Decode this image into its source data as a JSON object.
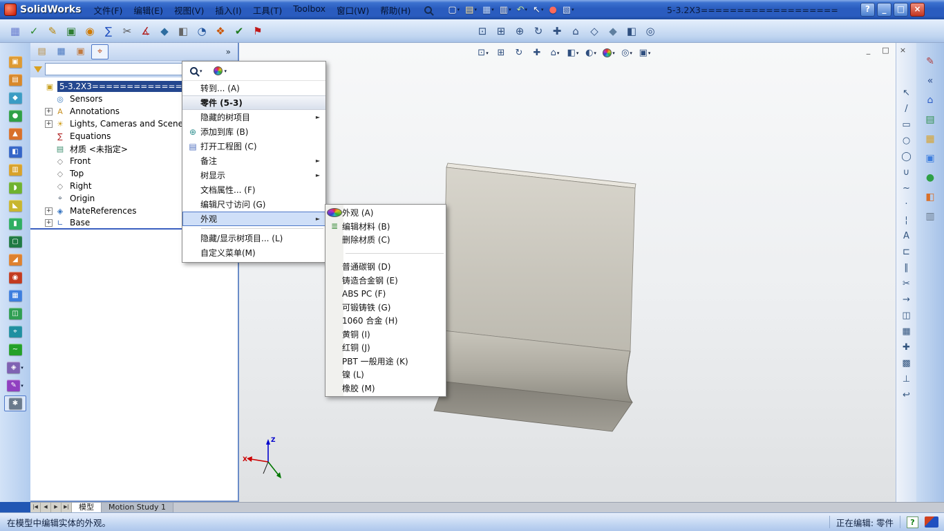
{
  "colors": {
    "selection": "#24478f",
    "menu_highlight": "#cfdff8",
    "menu_highlight_border": "#4d77c8",
    "chrome_blue": "#b2ccee"
  },
  "titlebar": {
    "logo": "SolidWorks",
    "doc_title": "5-3.2X3===================",
    "menus": [
      {
        "name": "menu-file",
        "label": "文件(F)"
      },
      {
        "name": "menu-edit",
        "label": "编辑(E)"
      },
      {
        "name": "menu-view",
        "label": "视图(V)"
      },
      {
        "name": "menu-insert",
        "label": "插入(I)"
      },
      {
        "name": "menu-tools",
        "label": "工具(T)"
      },
      {
        "name": "menu-toolbox",
        "label": "Toolbox"
      },
      {
        "name": "menu-window",
        "label": "窗口(W)"
      },
      {
        "name": "menu-help",
        "label": "帮助(H)"
      }
    ],
    "quick_icons": [
      {
        "name": "new-document-icon",
        "glyph": "▢",
        "color": "#ffffff",
        "drop": "▾"
      },
      {
        "name": "open-icon",
        "glyph": "▤",
        "color": "#ffe9a8",
        "drop": "▾"
      },
      {
        "name": "save-icon",
        "glyph": "▦",
        "color": "#bcd6ff",
        "drop": "▾"
      },
      {
        "name": "print-icon",
        "glyph": "▥",
        "color": "#e8e8e8",
        "drop": "▾"
      },
      {
        "name": "undo-icon",
        "glyph": "↶",
        "color": "#c4e6a6",
        "drop": "▾"
      },
      {
        "name": "select-arrow-icon",
        "glyph": "↖",
        "color": "#ffffff",
        "drop": "▾"
      },
      {
        "name": "rebuild-icon",
        "glyph": "●",
        "color": "#ff6a5a",
        "drop": ""
      },
      {
        "name": "options-icon",
        "glyph": "▧",
        "color": "#d6e4ff",
        "drop": "▾"
      }
    ],
    "window_buttons": [
      {
        "name": "help-button",
        "glyph": "?",
        "cls": ""
      },
      {
        "name": "minimize-button",
        "glyph": "_",
        "cls": ""
      },
      {
        "name": "maximize-button",
        "glyph": "□",
        "cls": ""
      },
      {
        "name": "close-button",
        "glyph": "×",
        "cls": "close"
      }
    ]
  },
  "toolbar_main": {
    "left_icons": [
      {
        "name": "sketch-grid-icon",
        "glyph": "▦",
        "color": "#6b7fd0"
      },
      {
        "name": "spell-check-icon",
        "glyph": "✓",
        "color": "#2e8b2e"
      },
      {
        "name": "note-icon",
        "glyph": "✎",
        "color": "#b8860b"
      },
      {
        "name": "design-check-icon",
        "glyph": "▣",
        "color": "#2e7d32"
      },
      {
        "name": "balloon-icon",
        "glyph": "◉",
        "color": "#d07a00"
      },
      {
        "name": "equation-icon",
        "glyph": "∑",
        "color": "#1f4fbf"
      },
      {
        "name": "trim-icon",
        "glyph": "✂",
        "color": "#555555"
      },
      {
        "name": "measure-icon",
        "glyph": "∡",
        "color": "#b02020"
      },
      {
        "name": "mass-properties-icon",
        "glyph": "◆",
        "color": "#2e6da0"
      },
      {
        "name": "section-properties-icon",
        "glyph": "◧",
        "color": "#666666"
      },
      {
        "name": "stopwatch-icon",
        "glyph": "◔",
        "color": "#24569e"
      },
      {
        "name": "exploded-view-icon",
        "glyph": "❖",
        "color": "#cc5500"
      },
      {
        "name": "check-feature-icon",
        "glyph": "✔",
        "color": "#1f7a1f"
      },
      {
        "name": "flag-icon",
        "glyph": "⚑",
        "color": "#c01818"
      }
    ],
    "right_icons": [
      {
        "name": "zoom-fit-icon",
        "glyph": "⊡",
        "color": "#2f4f7f"
      },
      {
        "name": "zoom-area-icon",
        "glyph": "⊞",
        "color": "#2f4f7f"
      },
      {
        "name": "zoom-in-out-icon",
        "glyph": "⊕",
        "color": "#2f4f7f"
      },
      {
        "name": "rotate-view-icon",
        "glyph": "↻",
        "color": "#2f4f7f"
      },
      {
        "name": "pan-icon",
        "glyph": "✚",
        "color": "#2f4f7f"
      },
      {
        "name": "standard-views-icon",
        "glyph": "⌂",
        "color": "#2f4f7f"
      },
      {
        "name": "wireframe-icon",
        "glyph": "◇",
        "color": "#2f4f7f"
      },
      {
        "name": "shaded-icon",
        "glyph": "◆",
        "color": "#5f7f9f"
      },
      {
        "name": "section-view-icon",
        "glyph": "◧",
        "color": "#2f4f7f"
      },
      {
        "name": "camera-view-icon",
        "glyph": "◎",
        "color": "#2f4f7f"
      }
    ]
  },
  "hud": {
    "icons": [
      {
        "name": "zoom-fit-hud-icon",
        "glyph": "⊡",
        "drop": "▾"
      },
      {
        "name": "zoom-area-hud-icon",
        "glyph": "⊞",
        "drop": ""
      },
      {
        "name": "rotate-hud-icon",
        "glyph": "↻",
        "drop": ""
      },
      {
        "name": "pan-hud-icon",
        "glyph": "✚",
        "drop": ""
      },
      {
        "name": "view-orientation-icon",
        "glyph": "⌂",
        "drop": "▾"
      },
      {
        "name": "display-style-icon",
        "glyph": "◧",
        "drop": "▾"
      },
      {
        "name": "hide-show-items-icon",
        "glyph": "◐",
        "drop": "▾"
      },
      {
        "name": "edit-appearance-hud-icon",
        "glyph": "",
        "iconclass": "sphere",
        "drop": "▾"
      },
      {
        "name": "apply-scene-icon",
        "glyph": "◎",
        "drop": "▾"
      },
      {
        "name": "view-settings-icon",
        "glyph": "▣",
        "drop": "▾"
      }
    ]
  },
  "child_controls": [
    {
      "name": "child-minimize-button",
      "glyph": "_"
    },
    {
      "name": "child-restore-button",
      "glyph": "□"
    },
    {
      "name": "child-close-button",
      "glyph": "×"
    }
  ],
  "left_toolbar": {
    "icons": [
      {
        "name": "favorites-tool-icon",
        "glyph": "▣",
        "color": "#de9a32",
        "drop": ""
      },
      {
        "name": "extrude-tool-icon",
        "glyph": "▤",
        "color": "#d8882a",
        "drop": ""
      },
      {
        "name": "revolve-tool-icon",
        "glyph": "◆",
        "color": "#3b9cc4",
        "drop": ""
      },
      {
        "name": "sweep-tool-icon",
        "glyph": "●",
        "color": "#2fa046",
        "drop": ""
      },
      {
        "name": "loft-tool-icon",
        "glyph": "▲",
        "color": "#d8702a",
        "drop": ""
      },
      {
        "name": "boundary-tool-icon",
        "glyph": "◧",
        "color": "#3465c8",
        "drop": ""
      },
      {
        "name": "cut-tool-icon",
        "glyph": "▥",
        "color": "#d8a22a",
        "drop": ""
      },
      {
        "name": "fillet-tool-icon",
        "glyph": "◗",
        "color": "#6fb22f",
        "drop": ""
      },
      {
        "name": "chamfer-tool-icon",
        "glyph": "◣",
        "color": "#c8b62f",
        "drop": ""
      },
      {
        "name": "rib-tool-icon",
        "glyph": "▮",
        "color": "#2fae62",
        "drop": ""
      },
      {
        "name": "shell-tool-icon",
        "glyph": "▢",
        "color": "#1f7a44",
        "drop": ""
      },
      {
        "name": "draft-tool-icon",
        "glyph": "◢",
        "color": "#de812f",
        "drop": ""
      },
      {
        "name": "hole-wizard-icon",
        "glyph": "◉",
        "color": "#c23a20",
        "drop": ""
      },
      {
        "name": "linear-pattern-icon",
        "glyph": "▦",
        "color": "#3d7ede",
        "drop": ""
      },
      {
        "name": "mirror-tool-icon",
        "glyph": "◫",
        "color": "#2f9e52",
        "drop": ""
      },
      {
        "name": "reference-geometry-icon",
        "glyph": "⌖",
        "color": "#1f8fa0",
        "drop": ""
      },
      {
        "name": "curves-tool-icon",
        "glyph": "~",
        "color": "#23a028",
        "drop": ""
      },
      {
        "name": "instant3d-icon",
        "glyph": "◈",
        "color": "#7f62b2",
        "drop": "▾"
      },
      {
        "name": "sketch-tools-icon",
        "glyph": "✎",
        "color": "#9040c0",
        "drop": "▾"
      },
      {
        "name": "edit-appearance-tool-icon",
        "glyph": "✱",
        "color": "#6a7a8c",
        "drop": "",
        "cls": "active"
      }
    ]
  },
  "sketch_toolbar": {
    "icons": [
      {
        "name": "select-icon",
        "glyph": "↖"
      },
      {
        "name": "line-icon",
        "glyph": "/"
      },
      {
        "name": "rectangle-icon",
        "glyph": "▭"
      },
      {
        "name": "circle-icon",
        "glyph": "○"
      },
      {
        "name": "ellipse-icon",
        "glyph": "◯"
      },
      {
        "name": "arc-icon",
        "glyph": "∪"
      },
      {
        "name": "spline-icon",
        "glyph": "~"
      },
      {
        "name": "point-icon",
        "glyph": "·"
      },
      {
        "name": "centerline-icon",
        "glyph": "¦"
      },
      {
        "name": "text-sketch-icon",
        "glyph": "A"
      },
      {
        "name": "convert-entities-icon",
        "glyph": "⊏"
      },
      {
        "name": "offset-entities-icon",
        "glyph": "∥"
      },
      {
        "name": "trim-entities-icon",
        "glyph": "✂"
      },
      {
        "name": "extend-entities-icon",
        "glyph": "→"
      },
      {
        "name": "mirror-entities-icon",
        "glyph": "◫"
      },
      {
        "name": "sketch-pattern-icon",
        "glyph": "▦"
      },
      {
        "name": "move-entities-icon",
        "glyph": "✚"
      },
      {
        "name": "grid-snap-icon",
        "glyph": "▩"
      },
      {
        "name": "relations-icon",
        "glyph": "⊥"
      },
      {
        "name": "exit-sketch-icon",
        "glyph": "↩"
      }
    ]
  },
  "task_pane": {
    "icons": [
      {
        "name": "pane-pencil-icon",
        "glyph": "✎",
        "color": "#b04040"
      },
      {
        "name": "pane-collapse-icon",
        "glyph": "«",
        "color": "#2f4f8f"
      },
      {
        "name": "home-icon",
        "glyph": "⌂",
        "color": "#2f5fc8"
      },
      {
        "name": "design-library-icon",
        "glyph": "▤",
        "color": "#2f8f4f"
      },
      {
        "name": "file-explorer-icon",
        "glyph": "▦",
        "color": "#d8a22a"
      },
      {
        "name": "view-palette-icon",
        "glyph": "▣",
        "color": "#3d7ede"
      },
      {
        "name": "appearances-scenes-icon",
        "glyph": "●",
        "color": "#2fa046"
      },
      {
        "name": "decals-icon",
        "glyph": "◧",
        "color": "#d8702a"
      },
      {
        "name": "custom-properties-icon",
        "glyph": "▥",
        "color": "#6a7a8c"
      }
    ]
  },
  "feature_tree": {
    "tabs": [
      {
        "name": "featuremanager-tab",
        "glyph": "▤",
        "color": "#b8904a",
        "cls": ""
      },
      {
        "name": "propertymanager-tab",
        "glyph": "▦",
        "color": "#4a78c0",
        "cls": ""
      },
      {
        "name": "configurationmanager-tab",
        "glyph": "▣",
        "color": "#c07a40",
        "cls": ""
      },
      {
        "name": "displaymanager-tab",
        "glyph": "⌖",
        "color": "#c05020",
        "cls": "active"
      }
    ],
    "chevron": "»",
    "filter": {
      "value": "",
      "drop": "▾"
    },
    "items": [
      {
        "name": "tree-item-root",
        "twisty": "",
        "glyph": "▣",
        "color": "#c8a020",
        "label": "5-3.2X3===============",
        "cls": "selected"
      },
      {
        "name": "tree-item-sensors",
        "twisty": "",
        "glyph": "◎",
        "color": "#3a7abf",
        "label": "Sensors",
        "cls": "ind1"
      },
      {
        "name": "tree-item-annotations",
        "twisty": "+",
        "glyph": "A",
        "color": "#c89020",
        "label": "Annotations",
        "cls": "ind1"
      },
      {
        "name": "tree-item-lights",
        "twisty": "+",
        "glyph": "☀",
        "color": "#d0a020",
        "label": "Lights, Cameras and Scene",
        "cls": "ind1"
      },
      {
        "name": "tree-item-equations",
        "twisty": "",
        "glyph": "∑",
        "color": "#b02020",
        "label": "Equations",
        "cls": "ind1"
      },
      {
        "name": "tree-item-material",
        "twisty": "",
        "glyph": "▤",
        "color": "#3f8f6f",
        "label": "材质 <未指定>",
        "cls": "ind1"
      },
      {
        "name": "tree-item-front-plane",
        "twisty": "",
        "glyph": "◇",
        "color": "#808080",
        "label": "Front",
        "cls": "ind1"
      },
      {
        "name": "tree-item-top-plane",
        "twisty": "",
        "glyph": "◇",
        "color": "#808080",
        "label": "Top",
        "cls": "ind1"
      },
      {
        "name": "tree-item-right-plane",
        "twisty": "",
        "glyph": "◇",
        "color": "#808080",
        "label": "Right",
        "cls": "ind1"
      },
      {
        "name": "tree-item-origin",
        "twisty": "",
        "glyph": "⌖",
        "color": "#607080",
        "label": "Origin",
        "cls": "ind1"
      },
      {
        "name": "tree-item-matereferences",
        "twisty": "+",
        "glyph": "◈",
        "color": "#2f6fbf",
        "label": "MateReferences",
        "cls": "ind1"
      },
      {
        "name": "tree-item-base",
        "twisty": "+",
        "glyph": "∟",
        "color": "#3f6fbf",
        "label": "Base",
        "cls": "ind1 base"
      }
    ]
  },
  "context_menu": {
    "toolbar": [
      {
        "name": "menu-zoom-button",
        "iconclass": "mag",
        "drop": "▾"
      },
      {
        "name": "menu-appearance-button",
        "iconclass": "sphere",
        "drop": "▾"
      }
    ],
    "items": [
      {
        "name": "menu-goto",
        "glyph": "",
        "label": "转到... (A)",
        "arrow": "",
        "cls": ""
      },
      {
        "name": "menu-part-header",
        "glyph": "",
        "label": "零件 (5-3)",
        "arrow": "",
        "cls": "header"
      },
      {
        "name": "menu-hidden-tree-items",
        "glyph": "",
        "label": "隐藏的树项目",
        "arrow": "►",
        "cls": ""
      },
      {
        "name": "menu-add-to-library",
        "glyph": "⊕",
        "color": "#2f8f8f",
        "label": "添加到库 (B)",
        "arrow": "",
        "cls": ""
      },
      {
        "name": "menu-open-drawing",
        "glyph": "▤",
        "color": "#4f6fbf",
        "label": "打开工程图 (C)",
        "arrow": "",
        "cls": ""
      },
      {
        "name": "menu-comment",
        "glyph": "",
        "label": "备注",
        "arrow": "►",
        "cls": ""
      },
      {
        "name": "menu-tree-display",
        "glyph": "",
        "label": "树显示",
        "arrow": "►",
        "cls": ""
      },
      {
        "name": "menu-document-properties",
        "glyph": "",
        "label": "文档属性... (F)",
        "arrow": "",
        "cls": ""
      },
      {
        "name": "menu-dimension-access",
        "glyph": "",
        "label": "编辑尺寸访问 (G)",
        "arrow": "",
        "cls": ""
      },
      {
        "name": "menu-appearance",
        "glyph": "",
        "label": "外观",
        "arrow": "►",
        "cls": "hl"
      },
      {
        "name": "menu-separator",
        "glyph": "",
        "label": "",
        "arrow": "",
        "cls": "sep"
      },
      {
        "name": "menu-hide-show-tree",
        "glyph": "",
        "label": "隐藏/显示树项目... (L)",
        "arrow": "",
        "cls": ""
      },
      {
        "name": "menu-customize",
        "glyph": "",
        "label": "自定义菜单(M)",
        "arrow": "",
        "cls": ""
      }
    ]
  },
  "appearance_submenu": {
    "items": [
      {
        "name": "submenu-appearance",
        "glyph": "",
        "iconclass": "sphere",
        "label": "外观 (A)",
        "cls": ""
      },
      {
        "name": "submenu-edit-material",
        "glyph": "≣",
        "color": "#3f8f3f",
        "label": "编辑材料 (B)",
        "cls": ""
      },
      {
        "name": "submenu-delete-material",
        "glyph": "",
        "label": "删除材质 (C)",
        "cls": ""
      },
      {
        "name": "submenu-separator",
        "glyph": "",
        "label": "",
        "cls": "sep"
      },
      {
        "name": "submenu-plain-carbon-steel",
        "glyph": "",
        "label": "普通碳钢 (D)",
        "cls": ""
      },
      {
        "name": "submenu-cast-alloy-steel",
        "glyph": "",
        "label": "铸造合金钢 (E)",
        "cls": ""
      },
      {
        "name": "submenu-abs-pc",
        "glyph": "",
        "label": "ABS PC (F)",
        "cls": ""
      },
      {
        "name": "submenu-malleable-cast-iron",
        "glyph": "",
        "label": "可锻铸铁 (G)",
        "cls": ""
      },
      {
        "name": "submenu-1060-alloy",
        "glyph": "",
        "label": "1060 合金 (H)",
        "cls": ""
      },
      {
        "name": "submenu-brass",
        "glyph": "",
        "label": "黄铜 (I)",
        "cls": ""
      },
      {
        "name": "submenu-copper",
        "glyph": "",
        "label": "红铜 (J)",
        "cls": ""
      },
      {
        "name": "submenu-pbt-general",
        "glyph": "",
        "label": "PBT 一般用途 (K)",
        "cls": ""
      },
      {
        "name": "submenu-nickel",
        "glyph": "",
        "label": "镍 (L)",
        "cls": ""
      },
      {
        "name": "submenu-rubber",
        "glyph": "",
        "label": "橡胶 (M)",
        "cls": ""
      }
    ]
  },
  "viewport": {
    "triad_z": "Z",
    "triad_x": "X"
  },
  "doc_tabs": {
    "nav": [
      {
        "name": "tab-first-button",
        "glyph": "|◀"
      },
      {
        "name": "tab-prev-button",
        "glyph": "◀"
      },
      {
        "name": "tab-next-button",
        "glyph": "▶"
      },
      {
        "name": "tab-last-button",
        "glyph": "▶|"
      }
    ],
    "tabs": [
      {
        "name": "tab-model",
        "label": "模型",
        "cls": "active"
      },
      {
        "name": "tab-motion-study",
        "label": "Motion Study 1",
        "cls": ""
      }
    ]
  },
  "status_bar": {
    "message": "在模型中编辑实体的外观。",
    "editing_label": "正在编辑: 零件",
    "help_glyph": "?"
  }
}
